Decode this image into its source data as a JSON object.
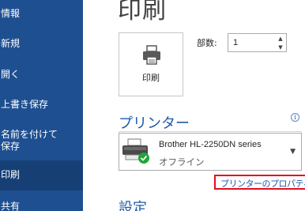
{
  "sidebar": {
    "items": [
      {
        "label": "情報"
      },
      {
        "label": "新規"
      },
      {
        "label": "開く"
      },
      {
        "label": "上書き保存"
      },
      {
        "label_line1": "名前を付けて",
        "label_line2": "保存"
      },
      {
        "label": "印刷"
      },
      {
        "label": "共有"
      }
    ]
  },
  "main": {
    "title": "印刷",
    "print_button_label": "印刷",
    "copies_label": "部数:",
    "copies_value": "1",
    "printer_section_title": "プリンター",
    "printer": {
      "name": "Brother HL-2250DN series",
      "status": "オフライン",
      "status_color": "#21a53a"
    },
    "printer_properties_link": "プリンターのプロパティ",
    "settings_section_title": "設定"
  },
  "colors": {
    "sidebar_bg": "#1e4f91",
    "sidebar_active": "#164075",
    "accent": "#1e5aa8",
    "highlight_border": "#e01020"
  }
}
